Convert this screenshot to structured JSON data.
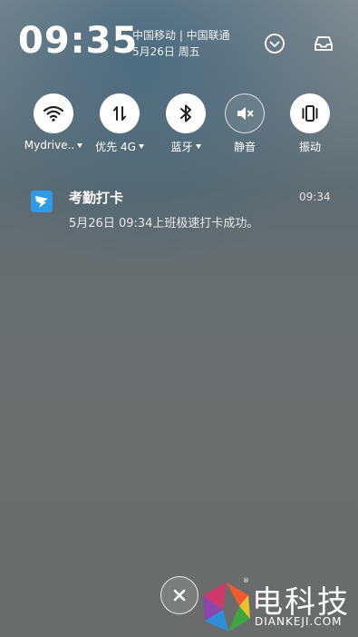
{
  "status": {
    "time": "09:35",
    "carrier": "中国移动 | 中国联通",
    "date": "5月26日 周五"
  },
  "quick_settings": {
    "wifi": {
      "label": "Mydrive..",
      "state": "on",
      "has_menu": true
    },
    "data": {
      "label": "优先 4G",
      "state": "on",
      "has_menu": true
    },
    "bluetooth": {
      "label": "蓝牙",
      "state": "on",
      "has_menu": true
    },
    "mute": {
      "label": "静音",
      "state": "off",
      "has_menu": false
    },
    "vibrate": {
      "label": "振动",
      "state": "on",
      "has_menu": false
    }
  },
  "notification": {
    "app": "考勤打卡",
    "time": "09:34",
    "message": "5月26日 09:34上班极速打卡成功。",
    "icon": "dingtalk-icon",
    "icon_color": "#2e9ae8"
  },
  "controls": {
    "close_icon": "close-icon",
    "expand_icon": "chevron-down-icon",
    "inbox_icon": "inbox-icon"
  },
  "watermark": {
    "brand_cn": "电科技",
    "brand_en": "DIANKEJI.COM",
    "registered": "®"
  }
}
